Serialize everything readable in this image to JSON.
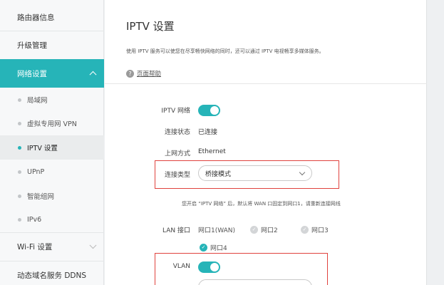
{
  "sidebar": {
    "items": [
      {
        "label": "路由器信息"
      },
      {
        "label": "升级管理"
      },
      {
        "label": "网络设置"
      },
      {
        "label": "Wi-Fi 设置"
      },
      {
        "label": "动态域名服务 DDNS"
      }
    ],
    "sub_items": [
      {
        "label": "局域网"
      },
      {
        "label": "虚拟专用网 VPN"
      },
      {
        "label": "IPTV 设置"
      },
      {
        "label": "UPnP"
      },
      {
        "label": "智能组网"
      },
      {
        "label": "IPv6"
      }
    ]
  },
  "main": {
    "title": "IPTV 设置",
    "description": "使用 IPTV 服务可以使您在尽享畅快网络的同时，还可以通过 IPTV 电视畅享多媒体服务。",
    "help_icon_glyph": "?",
    "help_label": "页面帮助",
    "fields": {
      "iptv_network_label": "IPTV 网络",
      "iptv_network_on": true,
      "connection_status_label": "连接状态",
      "connection_status_value": "已连接",
      "wan_mode_label": "上网方式",
      "wan_mode_value": "Ethernet",
      "connection_type_label": "连接类型",
      "connection_type_value": "桥接模式",
      "hint": "您开启 “IPTV 网络” 后，默认将 WAN 口固定到网口1，请重新连接网线",
      "lan_port_label": "LAN 接口",
      "lan_ports": [
        {
          "label": "网口1(WAN)",
          "checked": null
        },
        {
          "label": "网口2",
          "checked": false
        },
        {
          "label": "网口3",
          "checked": false
        },
        {
          "label": "网口4",
          "checked": true
        }
      ],
      "vlan_label": "VLAN",
      "vlan_on": true
    }
  },
  "colors": {
    "accent": "#26b4b8",
    "highlight_box": "#e0423e"
  },
  "icons": {
    "check": "✓"
  }
}
